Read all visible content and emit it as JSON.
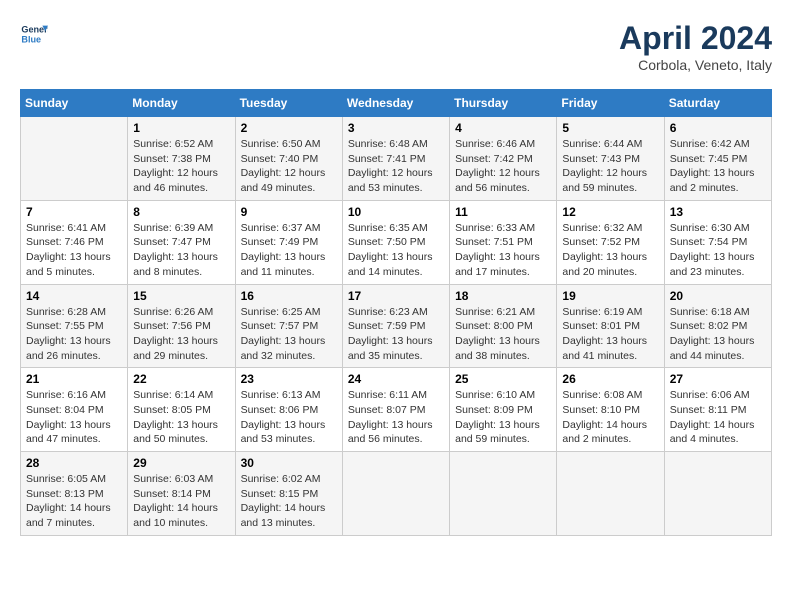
{
  "header": {
    "logo_line1": "General",
    "logo_line2": "Blue",
    "month": "April 2024",
    "location": "Corbola, Veneto, Italy"
  },
  "days_of_week": [
    "Sunday",
    "Monday",
    "Tuesday",
    "Wednesday",
    "Thursday",
    "Friday",
    "Saturday"
  ],
  "weeks": [
    [
      {
        "day": "",
        "info": ""
      },
      {
        "day": "1",
        "info": "Sunrise: 6:52 AM\nSunset: 7:38 PM\nDaylight: 12 hours\nand 46 minutes."
      },
      {
        "day": "2",
        "info": "Sunrise: 6:50 AM\nSunset: 7:40 PM\nDaylight: 12 hours\nand 49 minutes."
      },
      {
        "day": "3",
        "info": "Sunrise: 6:48 AM\nSunset: 7:41 PM\nDaylight: 12 hours\nand 53 minutes."
      },
      {
        "day": "4",
        "info": "Sunrise: 6:46 AM\nSunset: 7:42 PM\nDaylight: 12 hours\nand 56 minutes."
      },
      {
        "day": "5",
        "info": "Sunrise: 6:44 AM\nSunset: 7:43 PM\nDaylight: 12 hours\nand 59 minutes."
      },
      {
        "day": "6",
        "info": "Sunrise: 6:42 AM\nSunset: 7:45 PM\nDaylight: 13 hours\nand 2 minutes."
      }
    ],
    [
      {
        "day": "7",
        "info": "Sunrise: 6:41 AM\nSunset: 7:46 PM\nDaylight: 13 hours\nand 5 minutes."
      },
      {
        "day": "8",
        "info": "Sunrise: 6:39 AM\nSunset: 7:47 PM\nDaylight: 13 hours\nand 8 minutes."
      },
      {
        "day": "9",
        "info": "Sunrise: 6:37 AM\nSunset: 7:49 PM\nDaylight: 13 hours\nand 11 minutes."
      },
      {
        "day": "10",
        "info": "Sunrise: 6:35 AM\nSunset: 7:50 PM\nDaylight: 13 hours\nand 14 minutes."
      },
      {
        "day": "11",
        "info": "Sunrise: 6:33 AM\nSunset: 7:51 PM\nDaylight: 13 hours\nand 17 minutes."
      },
      {
        "day": "12",
        "info": "Sunrise: 6:32 AM\nSunset: 7:52 PM\nDaylight: 13 hours\nand 20 minutes."
      },
      {
        "day": "13",
        "info": "Sunrise: 6:30 AM\nSunset: 7:54 PM\nDaylight: 13 hours\nand 23 minutes."
      }
    ],
    [
      {
        "day": "14",
        "info": "Sunrise: 6:28 AM\nSunset: 7:55 PM\nDaylight: 13 hours\nand 26 minutes."
      },
      {
        "day": "15",
        "info": "Sunrise: 6:26 AM\nSunset: 7:56 PM\nDaylight: 13 hours\nand 29 minutes."
      },
      {
        "day": "16",
        "info": "Sunrise: 6:25 AM\nSunset: 7:57 PM\nDaylight: 13 hours\nand 32 minutes."
      },
      {
        "day": "17",
        "info": "Sunrise: 6:23 AM\nSunset: 7:59 PM\nDaylight: 13 hours\nand 35 minutes."
      },
      {
        "day": "18",
        "info": "Sunrise: 6:21 AM\nSunset: 8:00 PM\nDaylight: 13 hours\nand 38 minutes."
      },
      {
        "day": "19",
        "info": "Sunrise: 6:19 AM\nSunset: 8:01 PM\nDaylight: 13 hours\nand 41 minutes."
      },
      {
        "day": "20",
        "info": "Sunrise: 6:18 AM\nSunset: 8:02 PM\nDaylight: 13 hours\nand 44 minutes."
      }
    ],
    [
      {
        "day": "21",
        "info": "Sunrise: 6:16 AM\nSunset: 8:04 PM\nDaylight: 13 hours\nand 47 minutes."
      },
      {
        "day": "22",
        "info": "Sunrise: 6:14 AM\nSunset: 8:05 PM\nDaylight: 13 hours\nand 50 minutes."
      },
      {
        "day": "23",
        "info": "Sunrise: 6:13 AM\nSunset: 8:06 PM\nDaylight: 13 hours\nand 53 minutes."
      },
      {
        "day": "24",
        "info": "Sunrise: 6:11 AM\nSunset: 8:07 PM\nDaylight: 13 hours\nand 56 minutes."
      },
      {
        "day": "25",
        "info": "Sunrise: 6:10 AM\nSunset: 8:09 PM\nDaylight: 13 hours\nand 59 minutes."
      },
      {
        "day": "26",
        "info": "Sunrise: 6:08 AM\nSunset: 8:10 PM\nDaylight: 14 hours\nand 2 minutes."
      },
      {
        "day": "27",
        "info": "Sunrise: 6:06 AM\nSunset: 8:11 PM\nDaylight: 14 hours\nand 4 minutes."
      }
    ],
    [
      {
        "day": "28",
        "info": "Sunrise: 6:05 AM\nSunset: 8:13 PM\nDaylight: 14 hours\nand 7 minutes."
      },
      {
        "day": "29",
        "info": "Sunrise: 6:03 AM\nSunset: 8:14 PM\nDaylight: 14 hours\nand 10 minutes."
      },
      {
        "day": "30",
        "info": "Sunrise: 6:02 AM\nSunset: 8:15 PM\nDaylight: 14 hours\nand 13 minutes."
      },
      {
        "day": "",
        "info": ""
      },
      {
        "day": "",
        "info": ""
      },
      {
        "day": "",
        "info": ""
      },
      {
        "day": "",
        "info": ""
      }
    ]
  ]
}
